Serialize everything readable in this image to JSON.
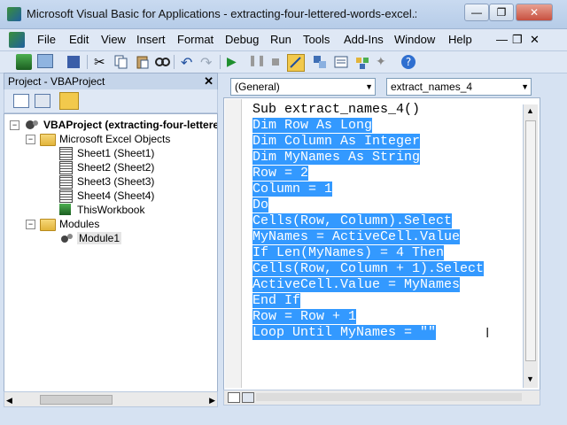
{
  "window": {
    "title": "Microsoft Visual Basic for Applications - extracting-four-lettered-words-excel.xlsm [desi...",
    "min": "—",
    "restore": "❐",
    "close": "✕"
  },
  "menu": [
    "File",
    "Edit",
    "View",
    "Insert",
    "Format",
    "Debug",
    "Run",
    "Tools",
    "Add-Ins",
    "Window",
    "Help"
  ],
  "menu_right": {
    "min": "—",
    "restore": "❐",
    "close": "✕"
  },
  "project": {
    "header": "Project - VBAProject",
    "close": "✕",
    "tree": {
      "root": "VBAProject (extracting-four-lettere",
      "excel_objects": "Microsoft Excel Objects",
      "sheets": [
        "Sheet1 (Sheet1)",
        "Sheet2 (Sheet2)",
        "Sheet3 (Sheet3)",
        "Sheet4 (Sheet4)"
      ],
      "workbook": "ThisWorkbook",
      "modules": "Modules",
      "module1": "Module1"
    }
  },
  "code_window": {
    "object_combo": "(General)",
    "proc_combo": "extract_names_4",
    "lines": [
      "Sub extract_names_4()",
      "Dim Row As Long",
      "Dim Column As Integer",
      "Dim MyNames As String",
      "Row = 2",
      "Column = 1",
      "Do",
      "Cells(Row, Column).Select",
      "MyNames = ActiveCell.Value",
      "If Len(MyNames) = 4 Then",
      "Cells(Row, Column + 1).Select",
      "ActiveCell.Value = MyNames",
      "End If",
      "Row = Row + 1",
      "Loop Until MyNames = \"\""
    ]
  },
  "colors": {
    "selection": "#3399ff",
    "chrome": "#dfe8f5"
  }
}
